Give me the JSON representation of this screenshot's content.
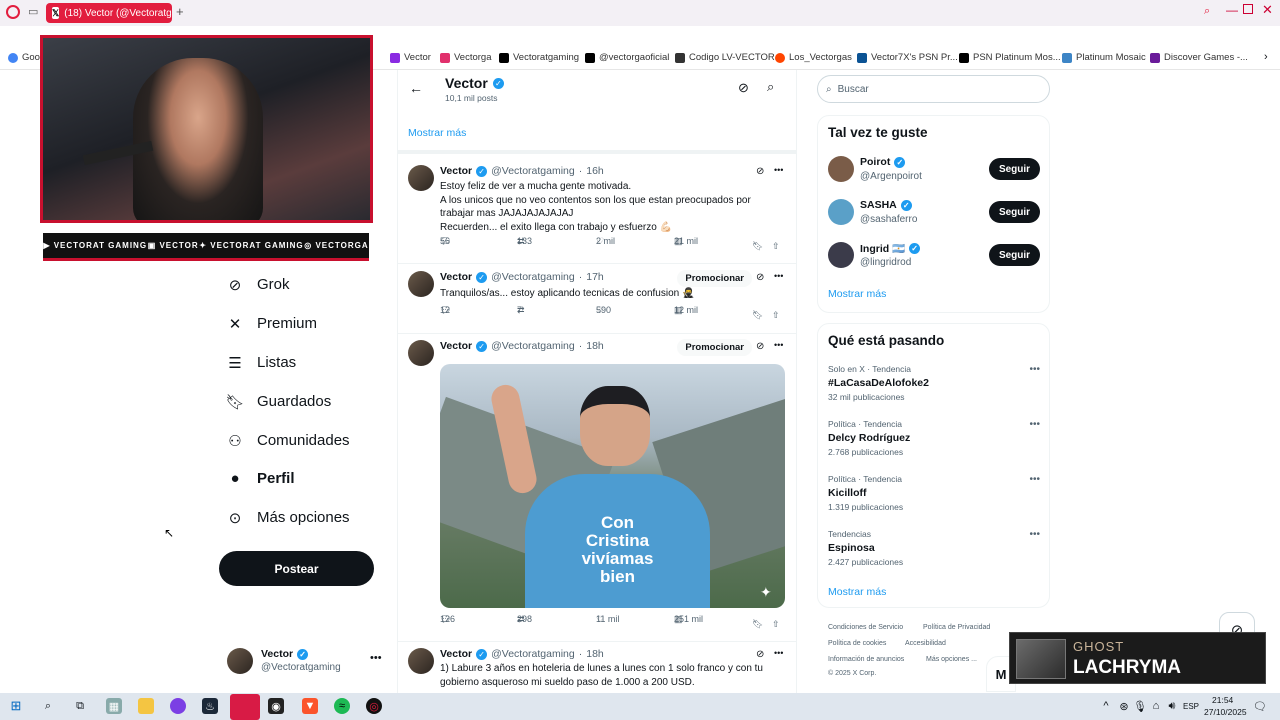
{
  "browser": {
    "tab_title": "(18) Vector (@Vectoratga",
    "bookmarks": [
      {
        "label": "Goog",
        "color": "#4285f4"
      },
      {
        "label": "Vector",
        "color": "#8a2be2"
      },
      {
        "label": "Vectorga",
        "color": "#e1306c"
      },
      {
        "label": "Vectoratgaming",
        "color": "#000000"
      },
      {
        "label": "@vectorgaoficial",
        "color": "#000000"
      },
      {
        "label": "Codigo LV-VECTOR",
        "color": "#333333"
      },
      {
        "label": "Los_Vectorgas",
        "color": "#ff4500"
      },
      {
        "label": "Vector7X's PSN Pr...",
        "color": "#0b5394"
      },
      {
        "label": "PSN Platinum Mos...",
        "color": "#000000"
      },
      {
        "label": "Platinum Mosaic",
        "color": "#3d85c6"
      },
      {
        "label": "Discover Games -...",
        "color": "#6a1b9a"
      }
    ]
  },
  "overlay": {
    "social": [
      "VECTORAT GAMING",
      "VECTOR",
      "VECTORAT GAMING",
      "VECTORGA"
    ]
  },
  "nav": {
    "items": [
      {
        "label": "Grok",
        "icon": "grok-icon"
      },
      {
        "label": "Premium",
        "icon": "x-logo-icon"
      },
      {
        "label": "Listas",
        "icon": "list-icon"
      },
      {
        "label": "Guardados",
        "icon": "bookmark-icon"
      },
      {
        "label": "Comunidades",
        "icon": "communities-icon"
      },
      {
        "label": "Perfil",
        "icon": "profile-icon"
      },
      {
        "label": "Más opciones",
        "icon": "more-circle-icon"
      }
    ],
    "post_button": "Postear",
    "account_name": "Vector",
    "account_handle": "@Vectoratgaming"
  },
  "profile_header": {
    "name": "Vector",
    "post_count": "10,1 mil posts",
    "show_more": "Mostrar más"
  },
  "tweets": [
    {
      "name": "Vector",
      "handle": "@Vectoratgaming",
      "time": "16h",
      "lines": [
        "Estoy feliz de ver a mucha gente motivada.",
        "A los unicos que no veo contentos son los que estan preocupados por",
        "trabajar mas JAJAJAJAJAJAJ",
        "Recuerden... el exito llega con trabajo y esfuerzo 💪🏻"
      ],
      "replies": "56",
      "reposts": "133",
      "likes": "2 mil",
      "views": "21 mil"
    },
    {
      "name": "Vector",
      "handle": "@Vectoratgaming",
      "time": "17h",
      "promo": "Promocionar",
      "lines": [
        "Tranquilos/as... estoy aplicando tecnicas de confusion 🥷"
      ],
      "replies": "12",
      "reposts": "7",
      "likes": "590",
      "views": "12 mil"
    },
    {
      "name": "Vector",
      "handle": "@Vectoratgaming",
      "time": "18h",
      "promo": "Promocionar",
      "shirt_text": [
        "Con",
        "Cristina",
        "vivíamas",
        "bien"
      ],
      "replies": "126",
      "reposts": "298",
      "likes": "11 mil",
      "views": "251 mil"
    },
    {
      "name": "Vector",
      "handle": "@Vectoratgaming",
      "time": "18h",
      "lines": [
        "1) Labure 3 años en hoteleria de lunes a lunes con 1 solo franco y con tu",
        "gobierno asqueroso mi sueldo paso de 1.000 a 200 USD."
      ]
    }
  ],
  "sidebar": {
    "search_placeholder": "Buscar",
    "who_to_follow_title": "Tal vez te guste",
    "who_to_follow": [
      {
        "name": "Poirot",
        "handle": "@Argenpoirot",
        "button": "Seguir",
        "color": "#7a5c48"
      },
      {
        "name": "SASHA",
        "handle": "@sashaferro",
        "button": "Seguir",
        "color": "#5aa0c8"
      },
      {
        "name": "Ingrid 🇦🇷",
        "handle": "@lingridrod",
        "button": "Seguir",
        "color": "#3b3b4a"
      }
    ],
    "show_more": "Mostrar más",
    "trends_title": "Qué está pasando",
    "trends": [
      {
        "category": "Solo en X · Tendencia",
        "title": "#LaCasaDeAlofoke2",
        "count": "32 mil publicaciones"
      },
      {
        "category": "Política · Tendencia",
        "title": "Delcy Rodríguez",
        "count": "2.768 publicaciones"
      },
      {
        "category": "Política · Tendencia",
        "title": "Kicilloff",
        "count": "1.319 publicaciones"
      },
      {
        "category": "Tendencias",
        "title": "Espinosa",
        "count": "2.427 publicaciones"
      }
    ],
    "trends_more": "Mostrar más",
    "footer": [
      "Condiciones de Servicio",
      "Política de Privacidad",
      "Política de cookies",
      "Accesibilidad",
      "Información de anuncios",
      "Más opciones ...",
      "© 2025 X Corp."
    ]
  },
  "ghost_panel": {
    "line1": "GHOST",
    "line2": "LACHRYMA"
  },
  "taskbar": {
    "language": "ESP",
    "time": "21:54",
    "date": "27/10/2025"
  },
  "colors": {
    "accent": "#1d9bf0",
    "overlay_red": "#c8102e",
    "tab_red": "#e21d3e"
  }
}
